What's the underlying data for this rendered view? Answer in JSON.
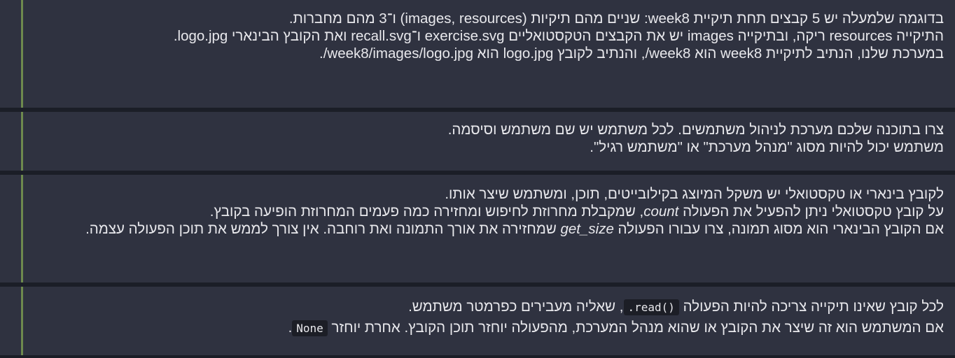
{
  "blocks": [
    {
      "lines": [
        "בדוגמה שלמעלה יש 5 קבצים תחת תיקיית week8: שניים מהם תיקיות (images, resources) ו־3 מהם מחברות.",
        "התיקייה resources ריקה, ובתיקייה images יש את הקבצים הטקסטואליים exercise.svg ו־recall.svg ואת הקובץ הבינארי logo.jpg.",
        "במערכת שלנו, הנתיב לתיקיית week8 הוא week8/, והנתיב לקובץ logo.jpg הוא week8/images/logo.jpg/."
      ]
    },
    {
      "lines": [
        "צרו בתוכנה שלכם מערכת לניהול משתמשים. לכל משתמש יש שם משתמש וסיסמה.",
        "משתמש יכול להיות מסוג \"מנהל מערכת\" או \"משתמש רגיל\"."
      ]
    },
    {
      "line1": "לקובץ בינארי או טקסטואלי יש משקל המיוצג בקילובייטים, תוכן, ומשתמש שיצר אותו.",
      "line2_before": "על קובץ טקסטואלי ניתן להפעיל את הפעולה ",
      "line2_term": "count",
      "line2_after": ", שמקבלת מחרוזת לחיפוש ומחזירה כמה פעמים המחרוזת הופיעה בקובץ.",
      "line3_before": "אם הקובץ הבינארי הוא מסוג תמונה, צרו עבורו הפעולה ",
      "line3_term": "get_size",
      "line3_after": " שמחזירה את אורך התמונה ואת רוחבה. אין צורך לממש את תוכן הפעולה עצמה."
    },
    {
      "line1_before": "לכל קובץ שאינו תיקייה צריכה להיות הפעולה ",
      "line1_code": ".read()",
      "line1_after": ", שאליה מעבירים כפרמטר משתמש.",
      "line2_before": "אם המשתמש הוא זה שיצר את הקובץ או שהוא מנהל המערכת, מהפעולה יוחזר תוכן הקובץ. אחרת יוחזר ",
      "line2_code": "None",
      "line2_after": "."
    }
  ]
}
